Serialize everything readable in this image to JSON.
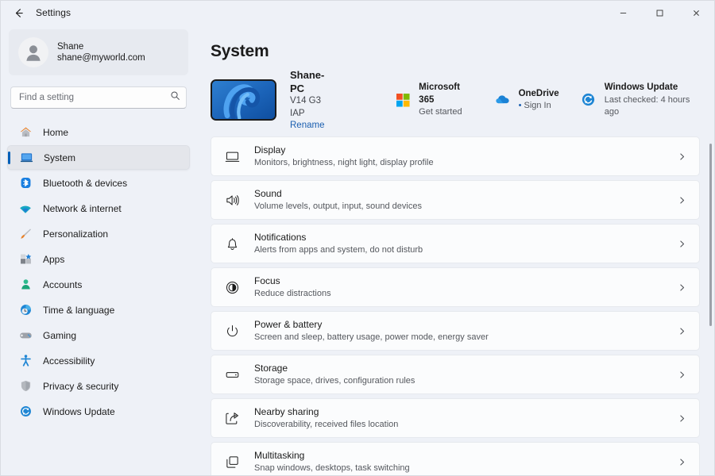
{
  "titlebar": {
    "back_label": "back-arrow",
    "title": "Settings",
    "minimize": "–",
    "maximize": "□",
    "close": "✕"
  },
  "sidebar": {
    "account": {
      "name": "Shane",
      "email": "shane@myworld.com"
    },
    "search": {
      "placeholder": "Find a setting",
      "value": ""
    },
    "items": [
      {
        "label": "Home",
        "icon": "home-icon",
        "selected": false
      },
      {
        "label": "System",
        "icon": "system-icon",
        "selected": true
      },
      {
        "label": "Bluetooth & devices",
        "icon": "bluetooth-icon",
        "selected": false
      },
      {
        "label": "Network & internet",
        "icon": "wifi-icon",
        "selected": false
      },
      {
        "label": "Personalization",
        "icon": "brush-icon",
        "selected": false
      },
      {
        "label": "Apps",
        "icon": "apps-icon",
        "selected": false
      },
      {
        "label": "Accounts",
        "icon": "person-icon",
        "selected": false
      },
      {
        "label": "Time & language",
        "icon": "clock-icon",
        "selected": false
      },
      {
        "label": "Gaming",
        "icon": "gamepad-icon",
        "selected": false
      },
      {
        "label": "Accessibility",
        "icon": "accessibility-icon",
        "selected": false
      },
      {
        "label": "Privacy & security",
        "icon": "shield-icon",
        "selected": false
      },
      {
        "label": "Windows Update",
        "icon": "update-icon",
        "selected": false
      }
    ]
  },
  "main": {
    "page_title": "System",
    "device": {
      "name": "Shane-PC",
      "model": "V14 G3 IAP",
      "rename_label": "Rename"
    },
    "status": [
      {
        "title": "Microsoft 365",
        "sub": "Get started",
        "icon": "microsoft-logo-icon"
      },
      {
        "title": "OneDrive",
        "sub": "Sign In",
        "bullet": "•",
        "icon": "onedrive-cloud-icon"
      },
      {
        "title": "Windows Update",
        "sub": "Last checked: 4 hours ago",
        "icon": "windows-update-icon"
      }
    ],
    "rows": [
      {
        "title": "Display",
        "sub": "Monitors, brightness, night light, display profile",
        "icon": "monitor-icon"
      },
      {
        "title": "Sound",
        "sub": "Volume levels, output, input, sound devices",
        "icon": "speaker-icon"
      },
      {
        "title": "Notifications",
        "sub": "Alerts from apps and system, do not disturb",
        "icon": "bell-icon"
      },
      {
        "title": "Focus",
        "sub": "Reduce distractions",
        "icon": "focus-icon"
      },
      {
        "title": "Power & battery",
        "sub": "Screen and sleep, battery usage, power mode, energy saver",
        "icon": "power-icon"
      },
      {
        "title": "Storage",
        "sub": "Storage space, drives, configuration rules",
        "icon": "drive-icon"
      },
      {
        "title": "Nearby sharing",
        "sub": "Discoverability, received files location",
        "icon": "share-icon"
      },
      {
        "title": "Multitasking",
        "sub": "Snap windows, desktops, task switching",
        "icon": "windows-stack-icon"
      }
    ]
  },
  "colors": {
    "accent": "#005fb8",
    "link": "#1b5fb0",
    "bg": "#eef1f7",
    "card": "#fbfcfd"
  }
}
